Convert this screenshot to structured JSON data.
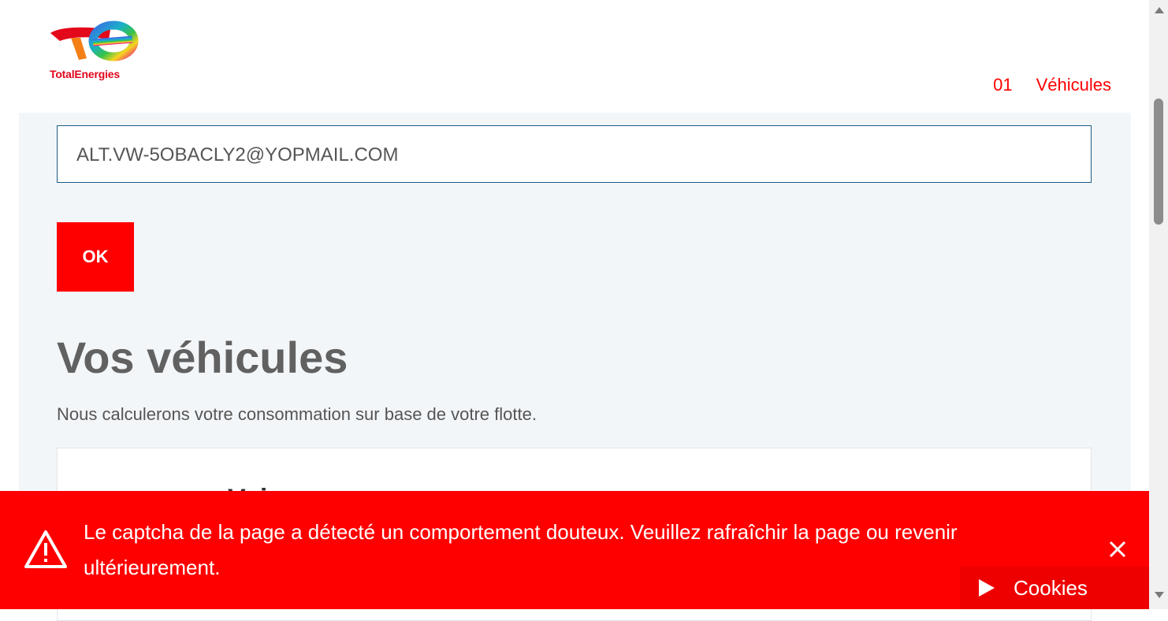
{
  "header": {
    "brand": "TotalEnergies",
    "step_number": "01",
    "step_label": "Véhicules"
  },
  "form": {
    "email_value": "ALT.VW-5OBACLY2@YOPMAIL.COM",
    "ok_label": "OK"
  },
  "vehicles": {
    "title": "Vos véhicules",
    "subtitle": "Nous calculerons votre consommation sur base de votre flotte.",
    "card_heading_partial": "Voi"
  },
  "alert": {
    "message": "Le captcha de la page a détecté un comportement douteux. Veuillez rafraîchir la page ou revenir ultérieurement.",
    "icon": "warning-icon",
    "close_icon": "close-icon"
  },
  "cookies": {
    "label": "Cookies",
    "icon": "play-icon"
  },
  "colors": {
    "accent": "#ff0000",
    "brand_red": "#e1061b",
    "page_bg": "#f3f6f9",
    "title": "#616161"
  }
}
